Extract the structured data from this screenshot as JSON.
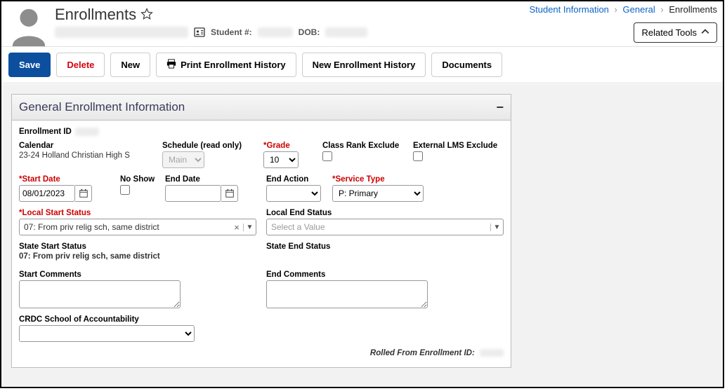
{
  "breadcrumb": {
    "a1": "Student Information",
    "a2": "General",
    "current": "Enrollments"
  },
  "page": {
    "title": "Enrollments",
    "student_label": "Student #:",
    "dob_label": "DOB:",
    "related_tools": "Related Tools"
  },
  "toolbar": {
    "save": "Save",
    "delete": "Delete",
    "new": "New",
    "print": "Print Enrollment History",
    "newhist": "New Enrollment History",
    "docs": "Documents"
  },
  "panel": {
    "title": "General Enrollment Information",
    "enroll_id_label": "Enrollment ID",
    "calendar_label": "Calendar",
    "calendar_value": "23-24 Holland Christian High S",
    "schedule_label": "Schedule (read only)",
    "schedule_value": "Main",
    "grade_label": "Grade",
    "grade_value": "10",
    "classrank_label": "Class Rank Exclude",
    "extlms_label": "External LMS Exclude",
    "startdate_label": "Start Date",
    "startdate_value": "08/01/2023",
    "noshow_label": "No Show",
    "enddate_label": "End Date",
    "endaction_label": "End Action",
    "servicetype_label": "Service Type",
    "servicetype_value": "P: Primary",
    "localstart_label": "Local Start Status",
    "localstart_value": "07: From priv relig sch, same district",
    "localend_label": "Local End Status",
    "localend_placeholder": "Select a Value",
    "statestart_label": "State Start Status",
    "statestart_value": "07: From priv relig sch, same district",
    "stateend_label": "State End Status",
    "startcomments_label": "Start Comments",
    "endcomments_label": "End Comments",
    "crdc_label": "CRDC School of Accountability",
    "footer": "Rolled From Enrollment ID:"
  }
}
